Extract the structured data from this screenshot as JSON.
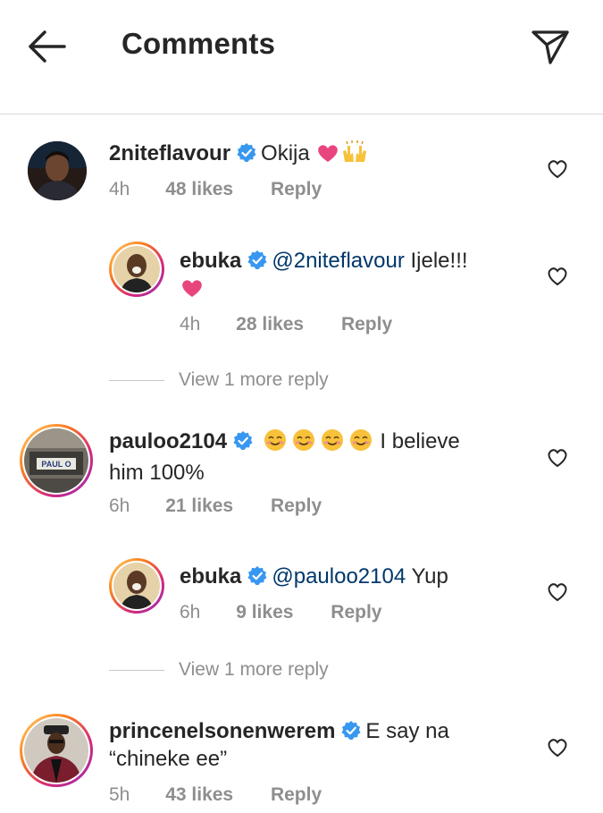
{
  "header": {
    "title": "Comments"
  },
  "comments": [
    {
      "username": "2niteflavour",
      "text": "Okija",
      "emoji": "❤🙌",
      "time": "4h",
      "likes": "48 likes",
      "reply": "Reply"
    },
    {
      "username": "ebuka",
      "mention": "@2niteflavour",
      "text": "Ijele!!!",
      "time": "4h",
      "likes": "28 likes",
      "reply": "Reply"
    },
    {
      "username": "pauloo2104",
      "text": "I believe",
      "text2": "him 100%",
      "time": "6h",
      "likes": "21 likes",
      "reply": "Reply"
    },
    {
      "username": "ebuka",
      "mention": "@pauloo2104",
      "text": "Yup",
      "time": "6h",
      "likes": "9 likes",
      "reply": "Reply"
    },
    {
      "username": "princenelsonenwerem",
      "text": "E say na",
      "text2": "“chineke ee”",
      "time": "5h",
      "likes": "43 likes",
      "reply": "Reply"
    }
  ],
  "view_more": [
    "View 1 more reply",
    "View 1 more reply"
  ],
  "avatar_labels": {
    "pauloo_plate": "PAUL O"
  },
  "colors": {
    "mention": "#00376b",
    "verified": "#3897f0",
    "meta": "#8e8e8e",
    "heart_emoji": "#e8457e"
  }
}
